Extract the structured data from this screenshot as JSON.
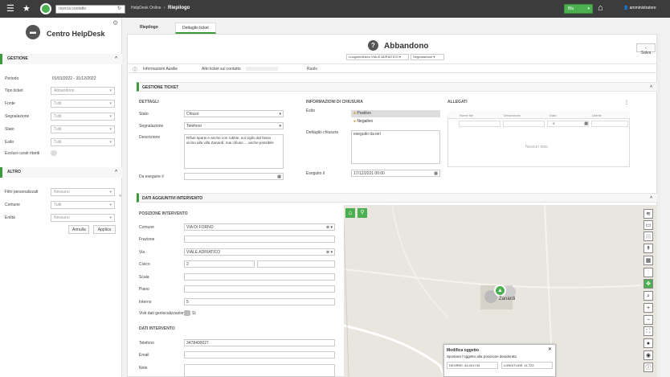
{
  "topbar": {
    "search_placeholder": "ricerca contatto",
    "breadcrumb_parent": "HelpDesk Online",
    "breadcrumb_current": "Riepilogo",
    "status_button": "Blu",
    "user": "amministratore"
  },
  "sidebar": {
    "title": "Centro HelpDesk",
    "section_gestione": "GESTIONE",
    "fields": [
      {
        "label": "Periodo",
        "value": "01/01/2022 - 31/12/2022"
      },
      {
        "label": "Tipo ticket",
        "value": "Abbandono"
      },
      {
        "label": "Fonte",
        "value": "Tutti"
      },
      {
        "label": "Segnalazione",
        "value": "Tutti"
      },
      {
        "label": "Stato",
        "value": "Tutti"
      },
      {
        "label": "Esito",
        "value": "Tutti"
      },
      {
        "label": "Esclusi curati ritardi",
        "value": ""
      }
    ],
    "section_altro": "ALTRO",
    "altro_fields": [
      {
        "label": "Filtri personalizzati",
        "value": "Nessuno"
      },
      {
        "label": "Comune",
        "value": "Tutti"
      },
      {
        "label": "Entità",
        "value": "Nessuno"
      }
    ],
    "btn_annulla": "Annulla",
    "btn_applica": "Applica"
  },
  "tabs": {
    "riepilogo": "Riepilogo",
    "dettaglio": "Dettaglio ticket"
  },
  "header": {
    "title": "Abbandono",
    "select1": "Luogo/indirizzo VIALE ADRIATICO",
    "select2": "Segnalazione",
    "save": "Salva"
  },
  "infobar": {
    "info": "Informazioni Ausilie",
    "azioni": "Altri ticket sul contatto",
    "ruolo": "Ruolo"
  },
  "gestione": {
    "title": "GESTIONE TICKET",
    "dettagli": "DETTAGLI",
    "stato_label": "Stato",
    "stato_value": "Chiuso",
    "segn_label": "Segnalazione",
    "segn_value": "Telefono",
    "desc_label": "Descrizione",
    "desc_value": "Rifiuti sparsi e anche con rubble, sul ciglio del fosso vicino alla villa Zanardi; mai chiuso ... anche possibile",
    "eseguire_label": "Da eseguire il",
    "chiusura_title": "INFORMAZIONI DI CHIUSURA",
    "esito_label": "Esito",
    "esito_pos": "Positivo",
    "esito_neg": "Negativo",
    "dettagli_chiusura_label": "Dettaglio chiusura",
    "dettagli_chiusura_value": "eseguito da ieri",
    "eseguito_label": "Eseguito il",
    "eseguito_value": "17/12/2021 00:00",
    "allegati_title": "ALLEGATI",
    "allegati_cols": [
      "Nome file",
      "Descrizione",
      "Data",
      "Utente"
    ],
    "allegati_empty": "Nessun dato"
  },
  "intervento": {
    "title": "DATI AGGIUNTIVI INTERVENTO",
    "posizione": "POSIZIONE INTERVENTO",
    "fields": [
      {
        "label": "Comune",
        "value": "VIA DI FORNO"
      },
      {
        "label": "Frazione",
        "value": ""
      },
      {
        "label": "Via",
        "value": "VIALE ADRIATICO"
      },
      {
        "label": "Civico",
        "value": "2"
      },
      {
        "label": "Scala",
        "value": ""
      },
      {
        "label": "Piano",
        "value": ""
      },
      {
        "label": "Interno",
        "value": "5"
      }
    ],
    "toggle_label": "Visti dati geolocalizzazione",
    "toggle_value": "Sì",
    "dati_title": "DATI INTERVENTO",
    "telefono_label": "Telefono",
    "telefono_value": "3478400027",
    "email_label": "Email",
    "note_label": "Note"
  },
  "map": {
    "popup_title": "Modifica oggetto",
    "popup_text": "Spostare l'oggetto alla posizione desiderata",
    "popup_coord1": "DEGREE: 44,001743",
    "popup_coord2": "LONGITUDE: 11,723",
    "map_label": "Zanardi"
  }
}
